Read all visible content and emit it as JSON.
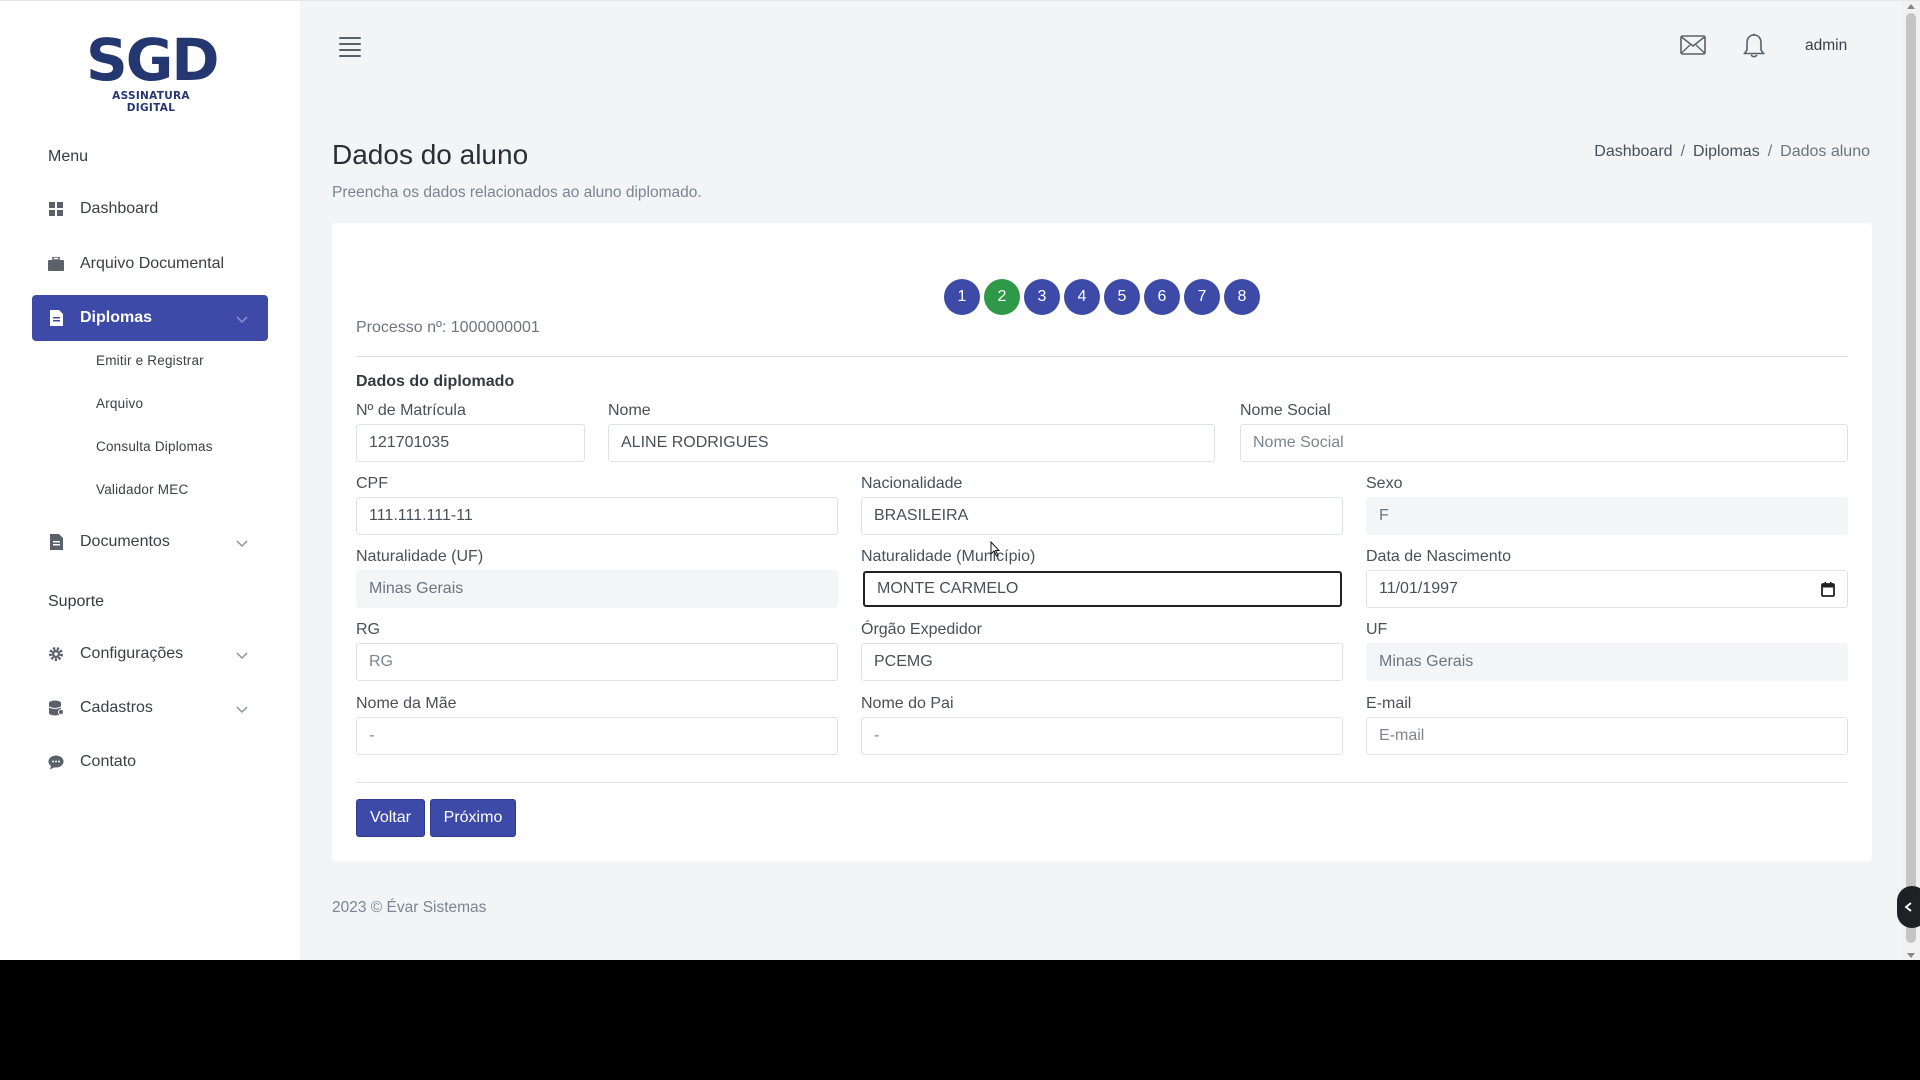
{
  "brand": {
    "name": "SGD",
    "tagline": "ASSINATURA DIGITAL"
  },
  "sidebar": {
    "section_menu": "Menu",
    "section_support": "Suporte",
    "items": [
      {
        "label": "Dashboard",
        "icon": "grid-icon"
      },
      {
        "label": "Arquivo Documental",
        "icon": "briefcase-icon"
      },
      {
        "label": "Diplomas",
        "icon": "document-icon",
        "active": true
      },
      {
        "label": "Documentos",
        "icon": "file-icon"
      },
      {
        "label": "Configurações",
        "icon": "gear-icon"
      },
      {
        "label": "Cadastros",
        "icon": "database-icon"
      },
      {
        "label": "Contato",
        "icon": "chat-icon"
      }
    ],
    "subitems": [
      "Emitir e Registrar",
      "Arquivo",
      "Consulta Diplomas",
      "Validador MEC"
    ]
  },
  "topbar": {
    "user": "admin"
  },
  "page": {
    "title": "Dados do aluno",
    "subtitle": "Preencha os dados relacionados ao aluno diplomado.",
    "breadcrumb": [
      "Dashboard",
      "Diplomas",
      "Dados aluno"
    ]
  },
  "steps": [
    "1",
    "2",
    "3",
    "4",
    "5",
    "6",
    "7",
    "8"
  ],
  "processo": "Processo nº: 1000000001",
  "form": {
    "section_title": "Dados do diplomado",
    "matricula": {
      "label": "Nº de Matrícula",
      "value": "121701035"
    },
    "nome": {
      "label": "Nome",
      "value": "ALINE RODRIGUES"
    },
    "nome_social": {
      "label": "Nome Social",
      "placeholder": "Nome Social"
    },
    "cpf": {
      "label": "CPF",
      "value": "111.111.111-11"
    },
    "nacionalidade": {
      "label": "Nacionalidade",
      "value": "BRASILEIRA"
    },
    "sexo": {
      "label": "Sexo",
      "value": "F"
    },
    "naturalidade_uf": {
      "label": "Naturalidade (UF)",
      "value": "Minas Gerais"
    },
    "naturalidade_municipio": {
      "label": "Naturalidade (Município)",
      "value": "MONTE CARMELO"
    },
    "data_nascimento": {
      "label": "Data de Nascimento",
      "value": "11/01/1997"
    },
    "rg": {
      "label": "RG",
      "placeholder": "RG"
    },
    "orgao_expedidor": {
      "label": "Órgão Expedidor",
      "value": "PCEMG"
    },
    "uf": {
      "label": "UF",
      "value": "Minas Gerais"
    },
    "nome_mae": {
      "label": "Nome da Mãe",
      "placeholder": "-"
    },
    "nome_pai": {
      "label": "Nome do Pai",
      "placeholder": "-"
    },
    "email": {
      "label": "E-mail",
      "placeholder": "E-mail"
    }
  },
  "buttons": {
    "back": "Voltar",
    "next": "Próximo"
  },
  "footer": "2023 © Évar Sistemas",
  "colors": {
    "primary": "#3d4aa8",
    "success": "#2e9a47",
    "brand": "#253770"
  }
}
